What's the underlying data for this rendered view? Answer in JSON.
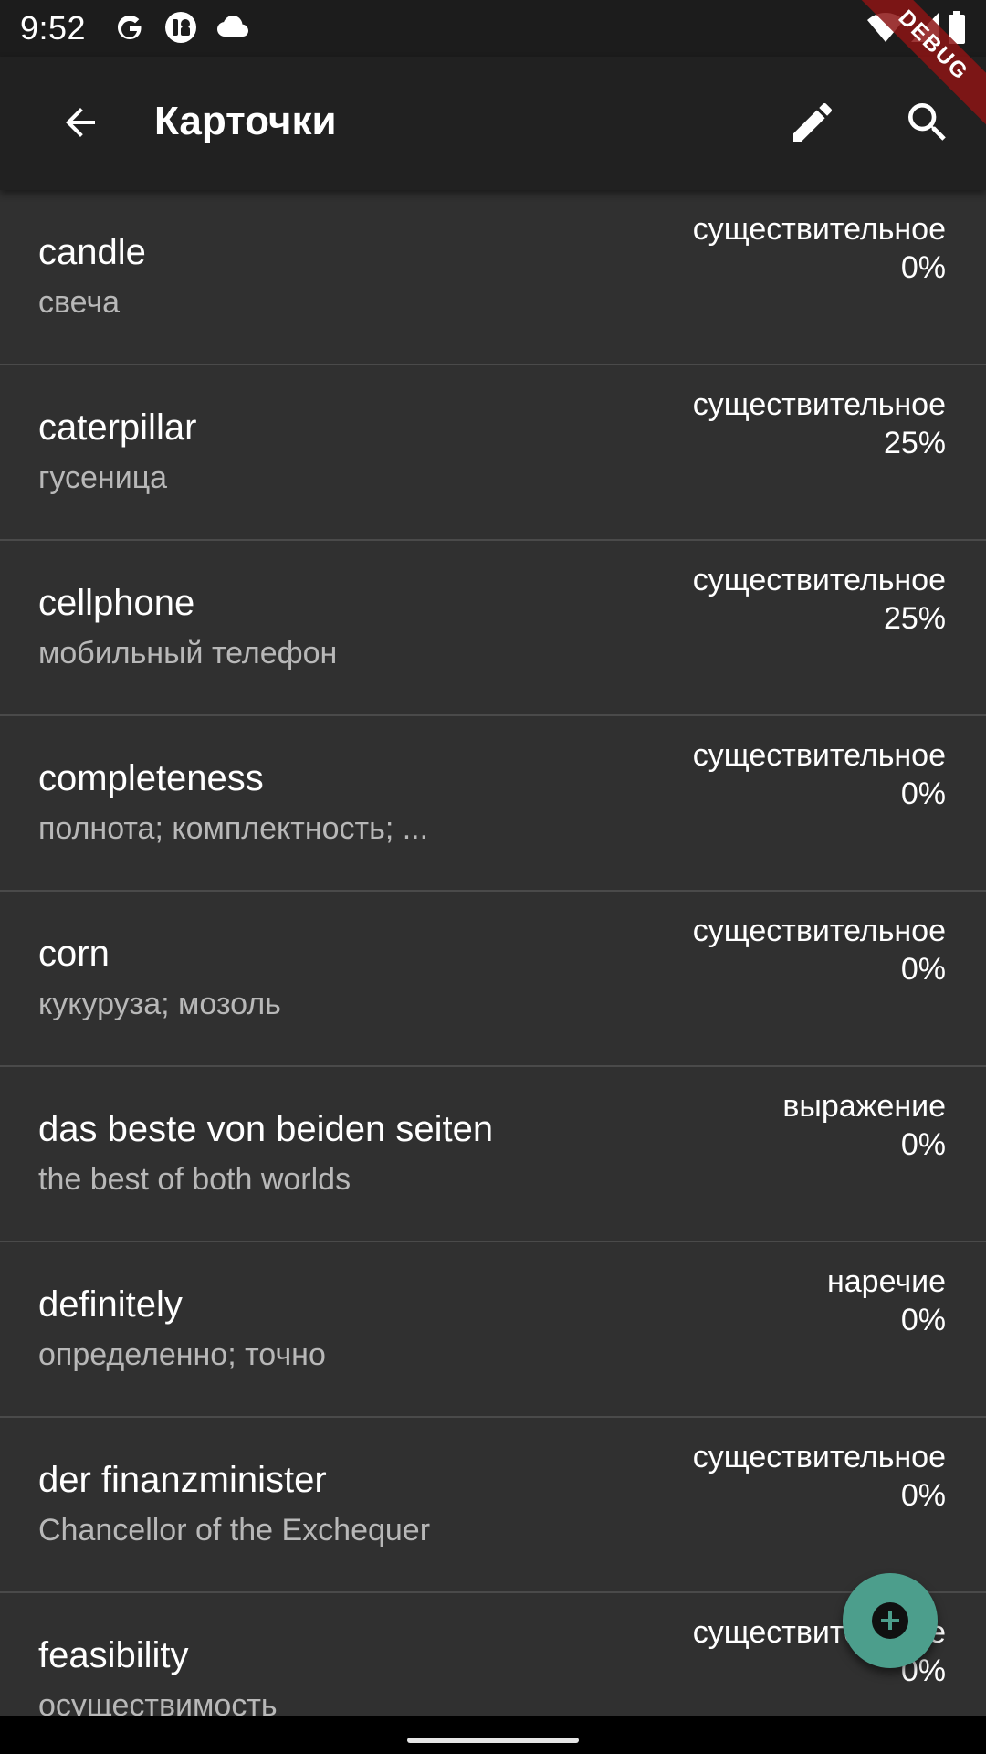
{
  "status_bar": {
    "time": "9:52",
    "icons": [
      "google-icon",
      "app-badge-icon",
      "cloud-icon",
      "wifi-icon",
      "cell-signal-icon",
      "battery-icon"
    ]
  },
  "debug_banner": "DEBUG",
  "app_bar": {
    "title": "Карточки",
    "back_icon": "arrow-back-icon",
    "actions": [
      "edit-icon",
      "search-icon"
    ]
  },
  "cards": [
    {
      "word": "candle",
      "translation": "свеча",
      "type": "существительное",
      "progress": "0%"
    },
    {
      "word": "caterpillar",
      "translation": "гусеница",
      "type": "существительное",
      "progress": "25%"
    },
    {
      "word": "cellphone",
      "translation": "мобильный телефон",
      "type": "существительное",
      "progress": "25%"
    },
    {
      "word": "completeness",
      "translation": "полнота; комплектность; ...",
      "type": "существительное",
      "progress": "0%"
    },
    {
      "word": "corn",
      "translation": "кукуруза; мозоль",
      "type": "существительное",
      "progress": "0%"
    },
    {
      "word": "das beste von beiden seiten",
      "translation": "the best of both worlds",
      "type": "выражение",
      "progress": "0%"
    },
    {
      "word": "definitely",
      "translation": "определенно; точно",
      "type": "наречие",
      "progress": "0%"
    },
    {
      "word": "der finanzminister",
      "translation": "Chancellor of the Exchequer",
      "type": "существительное",
      "progress": "0%"
    },
    {
      "word": "feasibility",
      "translation": "осуществимость",
      "type": "существительное",
      "progress": "0%"
    }
  ],
  "fab": {
    "icon": "add-icon"
  },
  "colors": {
    "status_bar_bg": "#1c1c1c",
    "app_bar_bg": "#212121",
    "list_bg": "#303030",
    "divider": "#4a4a4a",
    "fab_bg": "#4c9e8c",
    "debug_ribbon": "#8c1414"
  }
}
